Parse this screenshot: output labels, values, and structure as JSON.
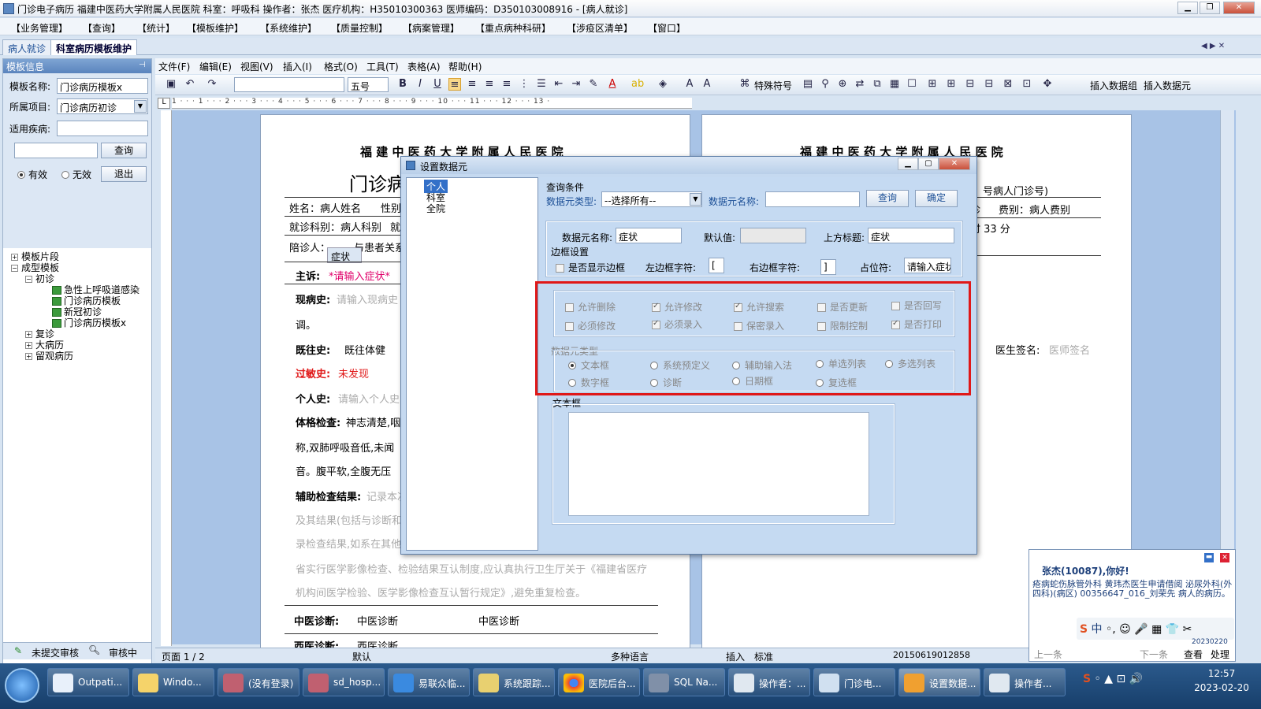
{
  "window": {
    "title": "门诊电子病历  福建中医药大学附属人民医院  科室：呼吸科  操作者：张杰  医疗机构：H35010300363  医师编码：D350103008916 - [病人就诊]"
  },
  "menubar": [
    "【业务管理】",
    "【查询】",
    "【统计】",
    "【模板维护】",
    "【系统维护】",
    "【质量控制】",
    "【病案管理】",
    "【重点病种科研】",
    "【涉疫区清单】",
    "【窗口】"
  ],
  "tabs": [
    "病人就诊",
    "科室病历模板维护"
  ],
  "left": {
    "header": "模板信息",
    "name_label": "模板名称:",
    "name_value": "门诊病历模板x",
    "project_label": "所属项目:",
    "project_value": "门诊病历初诊",
    "disease_label": "适用疾病:",
    "query_btn": "查询",
    "exit_btn": "退出",
    "valid": "有效",
    "invalid": "无效",
    "tree": [
      "模板片段",
      "成型模板",
      "初诊",
      "急性上呼吸道感染",
      "门诊病历模板",
      "新冠初诊",
      "门诊病历模板x",
      "复诊",
      "大病历",
      "留观病历"
    ],
    "foot_submit": "未提交审核",
    "foot_review": "审核中"
  },
  "editormenu": [
    "文件(F)",
    "编辑(E)",
    "视图(V)",
    "插入(I)",
    "格式(O)",
    "工具(T)",
    "表格(A)",
    "帮助(H)"
  ],
  "toolbar": {
    "fontsize": "五号",
    "special": "特殊符号",
    "insert_group": "插入数据组",
    "insert_elem": "插入数据元"
  },
  "ruler": "1 · · · 1 · · · 2 · · · 3 · · · 4 · · · 5 · · · 6 · · · 7 · · · 8 · · · 9 · · · 10 · · · 11 · · · 12 · · · 13 ·",
  "doc": {
    "hospital": "福 建 中 医 药 大 学 附 属 人 民 医 院",
    "title": "门诊病",
    "name": "姓名：病人姓名",
    "sex": "性别",
    "dept": "就诊科别：病人科别",
    "jiu": "就",
    "companion": "陪诊人：",
    "relation": "与患者关系",
    "chief_label": "主诉:",
    "chief_value": "*请输入症状*",
    "tag": "症状",
    "hpi_label": "现病史:",
    "hpi_value": "请输入现病史",
    "tiao": "调。",
    "past_label": "既往史:",
    "past_value": "既往体健",
    "allergy_label": "过敏史:",
    "allergy_value": "未发现",
    "personal_label": "个人史:",
    "personal_value": "请输入个人史",
    "exam_label": "体格检查:",
    "exam_value": "神志清楚,咽",
    "exam_l2": "称,双肺呼吸音低,未闻",
    "exam_l3": "音。腹平软,全腹无压",
    "aux_label": "辅助检查结果:",
    "aux_value": "记录本次",
    "aux_l2": "及其结果(包括与诊断和",
    "aux_l3": "录检查结果,如系在其他",
    "aux_l4": "省实行医学影像检查、检验结果互认制度,应认真执行卫生厅关于《福建省医疗",
    "aux_l5": "机构间医学检验、医学影像检查互认暂行规定》,避免重复检查。",
    "tcm_label": "中医诊断:",
    "tcm_v1": "中医诊断",
    "tcm_v2": "中医诊断",
    "west_label": "西医诊断:",
    "west_v1": "西医诊断"
  },
  "doc2": {
    "hospital": "福 建 中 医 药 大 学 附 属 人 民 医 院",
    "outpatient_no": "号病人门诊号)",
    "fee_dept": "诊",
    "fee": "费别：病人费别",
    "time": "时 33 分",
    "doctor_label": "医生签名:",
    "doctor_value": "医师签名"
  },
  "dialog": {
    "title": "设置数据元",
    "tree": [
      "个人",
      "科室",
      "全院"
    ],
    "query_cond": "查询条件",
    "type_label": "数据元类型:",
    "type_value": "--选择所有--",
    "name_label": "数据元名称:",
    "query_btn": "查询",
    "ok_btn": "确定",
    "elem_name_label": "数据元名称:",
    "elem_name_value": "症状",
    "default_label": "默认值:",
    "upper_label": "上方标题:",
    "upper_value": "症状",
    "border_label": "边框设置",
    "show_border": "是否显示边框",
    "left_border_label": "左边框字符:",
    "left_border_value": "[",
    "right_border_label": "右边框字符:",
    "right_border_value": "]",
    "placeholder_label": "占位符:",
    "placeholder_value": "请输入症状",
    "checks": [
      {
        "label": "允许删除",
        "on": false
      },
      {
        "label": "允许修改",
        "on": true
      },
      {
        "label": "允许搜索",
        "on": true
      },
      {
        "label": "是否更新",
        "on": false
      },
      {
        "label": "是否回写",
        "on": false
      },
      {
        "label": "必须修改",
        "on": false
      },
      {
        "label": "必须录入",
        "on": true
      },
      {
        "label": "保密录入",
        "on": false
      },
      {
        "label": "限制控制",
        "on": false
      },
      {
        "label": "是否打印",
        "on": true
      }
    ],
    "type_group": "数据元类型",
    "types": [
      "文本框",
      "系统预定义",
      "辅助输入法",
      "单选列表",
      "多选列表",
      "数字框",
      "诊断",
      "日期框",
      "复选框"
    ],
    "textbox_label": "文本框"
  },
  "status": {
    "page": "页面 1 / 2",
    "default": "默认",
    "lang": "多种语言",
    "insert": "插入",
    "standard": "标准",
    "code": "20150619012858"
  },
  "popup": {
    "greeting": "张杰(10087),你好!",
    "message": "疮病蛇伤脉管外科  黄玮杰医生申请借阅  泌尿外科(外四科)(病区) 00356647_016_刘荣先  病人的病历。",
    "prev": "上一条",
    "next": "下一条",
    "view": "查看",
    "handle": "处理",
    "date_hint": "20230220"
  },
  "taskbar": {
    "items": [
      "Outpati...",
      "Windo...",
      "(没有登录)",
      "sd_hosp...",
      "易联众临...",
      "系统跟踪...",
      "医院后台...",
      "SQL Na...",
      "操作者：...",
      "门诊电...",
      "设置数据...",
      "操作者..."
    ],
    "time": "12:57",
    "date": "2023-02-20",
    "ime": "中"
  }
}
